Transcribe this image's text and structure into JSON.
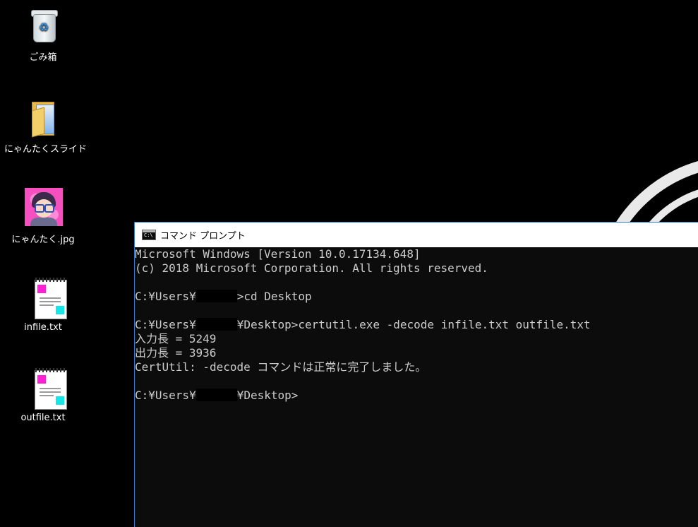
{
  "desktop": {
    "icons": [
      {
        "label": "ごみ箱",
        "icon": "recycle-bin-icon"
      },
      {
        "label": "にゃんたくスライド",
        "icon": "folder-icon"
      },
      {
        "label": "にゃんたく.jpg",
        "icon": "image-file-icon"
      },
      {
        "label": "infile.txt",
        "icon": "text-file-icon"
      },
      {
        "label": "outfile.txt",
        "icon": "text-file-icon"
      }
    ]
  },
  "cmd": {
    "title": "コマンド プロンプト",
    "icon_text": "C:\\",
    "lines": [
      "Microsoft Windows [Version 10.0.17134.648]",
      "(c) 2018 Microsoft Corporation. All rights reserved.",
      "",
      "C:¥Users¥",
      ">cd Desktop",
      "",
      "C:¥Users¥",
      "¥Desktop>certutil.exe -decode infile.txt outfile.txt",
      "入力長 = 5249",
      "出力長 = 3936",
      "CertUtil: -decode コマンドは正常に完了しました。",
      "",
      "C:¥Users¥",
      "¥Desktop>"
    ]
  },
  "colors": {
    "console_bg": "#0c0c0c",
    "console_text": "#cccccc",
    "window_border": "#2f7bd6",
    "desktop_bg": "#000000"
  }
}
